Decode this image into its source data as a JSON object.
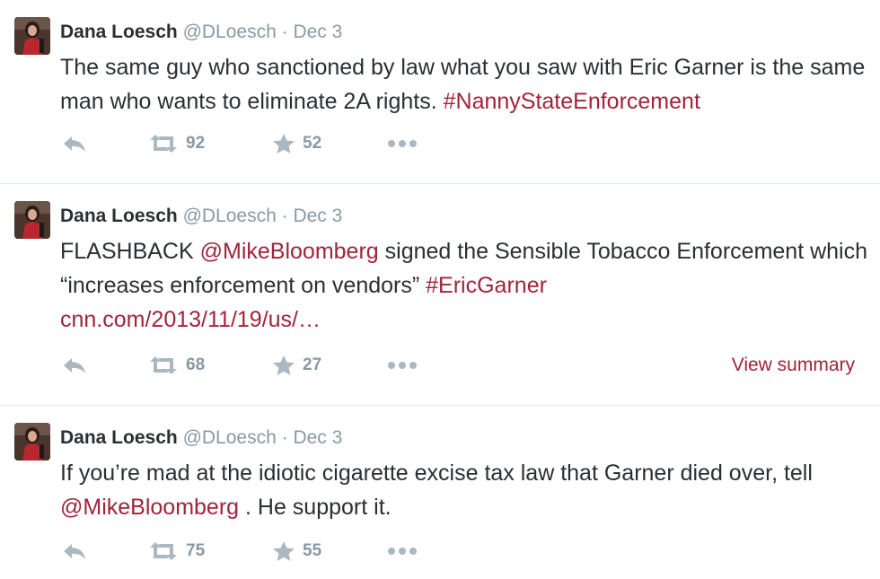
{
  "colors": {
    "link": "#a0243a",
    "muted": "#8899a6",
    "icon": "#aab8c2",
    "text": "#292f33",
    "divider": "#e1e8ed"
  },
  "tweets": [
    {
      "author": "Dana Loesch",
      "handle": "@DLoesch",
      "separator": "·",
      "date": "Dec 3",
      "body": {
        "text1": "The same guy who sanctioned by law what you saw with Eric Garner is the same man who wants to eliminate 2A rights.",
        "hashtag1": "#NannyStateEnforcement"
      },
      "retweets": "92",
      "favorites": "52"
    },
    {
      "author": "Dana Loesch",
      "handle": "@DLoesch",
      "separator": "·",
      "date": "Dec 3",
      "body": {
        "text1": "FLASHBACK",
        "mention1": "@MikeBloomberg",
        "text2": "signed the Sensible Tobacco Enforcement which “increases enforcement on vendors”",
        "hashtag1": "#EricGarner",
        "url": "cnn.com/2013/11/19/us/…"
      },
      "retweets": "68",
      "favorites": "27",
      "view_summary": "View summary"
    },
    {
      "author": "Dana Loesch",
      "handle": "@DLoesch",
      "separator": "·",
      "date": "Dec 3",
      "body": {
        "text1": "If you’re mad at the idiotic cigarette excise tax law that Garner died over, tell",
        "mention1": "@MikeBloomberg",
        "text2": ". He support it."
      },
      "retweets": "75",
      "favorites": "55"
    }
  ]
}
